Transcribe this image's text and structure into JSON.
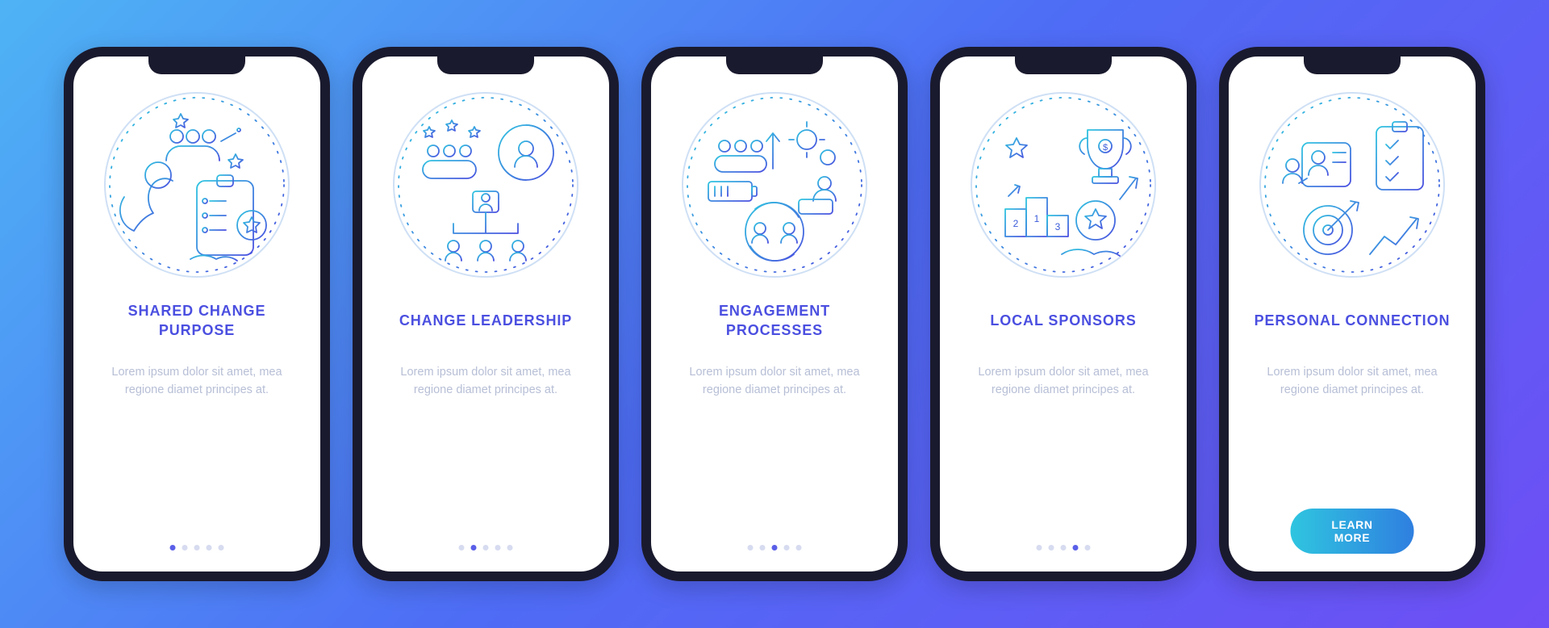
{
  "cta_label": "LEARN MORE",
  "shared_description": "Lorem ipsum dolor sit amet, mea regione diamet principes at.",
  "screens": [
    {
      "id": "shared-change-purpose",
      "title": "SHARED CHANGE PURPOSE",
      "icon": "shared-purpose-icon",
      "active_dot": 0,
      "has_cta": false
    },
    {
      "id": "change-leadership",
      "title": "CHANGE LEADERSHIP",
      "icon": "change-leadership-icon",
      "active_dot": 1,
      "has_cta": false
    },
    {
      "id": "engagement-processes",
      "title": "ENGAGEMENT PROCESSES",
      "icon": "engagement-processes-icon",
      "active_dot": 2,
      "has_cta": false
    },
    {
      "id": "local-sponsors",
      "title": "LOCAL SPONSORS",
      "icon": "local-sponsors-icon",
      "active_dot": 3,
      "has_cta": false
    },
    {
      "id": "personal-connection",
      "title": "PERSONAL CONNECTION",
      "icon": "personal-connection-icon",
      "active_dot": 4,
      "has_cta": true
    }
  ],
  "colors": {
    "gradient_start": "#2fc5e0",
    "gradient_end": "#4b4fe0",
    "title": "#4b4fe0",
    "body_text": "#b7bfd6",
    "dot_inactive": "#d6dbf0",
    "dot_active": "#5a5fe8"
  }
}
